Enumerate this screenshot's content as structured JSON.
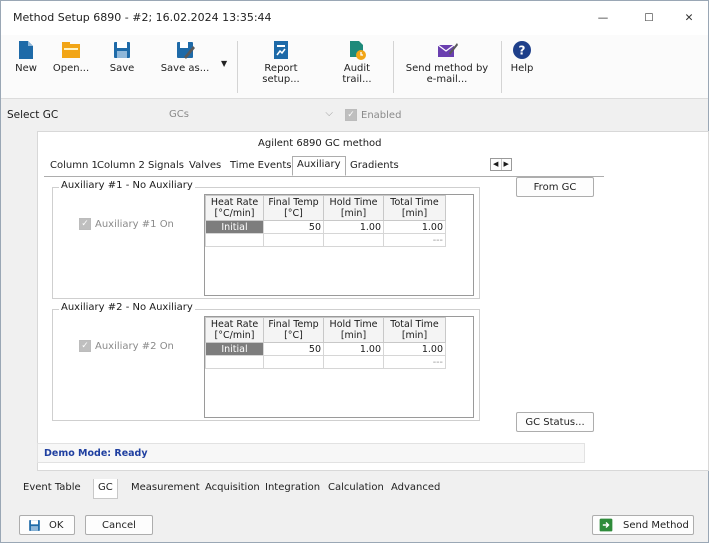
{
  "window": {
    "title": "Method Setup 6890 - #2;  16.02.2024  13:35:44",
    "controls": {
      "minimize": "—",
      "maximize": "☐",
      "close": "✕"
    }
  },
  "toolbar": {
    "new": "New",
    "open": "Open...",
    "save": "Save",
    "save_as": "Save as...",
    "report_setup": "Report setup...",
    "audit_trail": "Audit trail...",
    "send_method_line1": "Send method by",
    "send_method_line2": "e-mail...",
    "help": "Help"
  },
  "select_gc": {
    "label": "Select GC",
    "value": "GCs",
    "enabled_label": "Enabled"
  },
  "method": {
    "heading": "Agilent 6890 GC method",
    "tabs": [
      "Column 1",
      "Column 2",
      "Signals",
      "Valves",
      "Time Events",
      "Auxiliary",
      "Gradients"
    ],
    "active_tab": "Auxiliary"
  },
  "aux1": {
    "title": "Auxiliary #1 - No Auxiliary",
    "checkbox_label": "Auxiliary #1 On",
    "headers": [
      "Heat Rate\n[°C/min]",
      "Final Temp\n[°C]",
      "Hold Time\n[min]",
      "Total Time\n[min]"
    ],
    "h1": "Heat Rate",
    "h1u": "[°C/min]",
    "h2": "Final Temp",
    "h2u": "[°C]",
    "h3": "Hold Time",
    "h3u": "[min]",
    "h4": "Total Time",
    "h4u": "[min]",
    "row1": {
      "rate": "Initial",
      "temp": "50",
      "hold": "1.00",
      "total": "1.00"
    },
    "row2": {
      "total": "---"
    }
  },
  "aux2": {
    "title": "Auxiliary #2 - No Auxiliary",
    "checkbox_label": "Auxiliary #2 On",
    "h1": "Heat Rate",
    "h1u": "[°C/min]",
    "h2": "Final Temp",
    "h2u": "[°C]",
    "h3": "Hold Time",
    "h3u": "[min]",
    "h4": "Total Time",
    "h4u": "[min]",
    "row1": {
      "rate": "Initial",
      "temp": "50",
      "hold": "1.00",
      "total": "1.00"
    },
    "row2": {
      "total": "---"
    }
  },
  "buttons": {
    "from_gc": "From GC",
    "gc_status": "GC Status...",
    "ok": "OK",
    "cancel": "Cancel",
    "send_method": "Send Method"
  },
  "status_text": "Demo Mode: Ready",
  "bottom_tabs": [
    "Event Table",
    "GC",
    "Measurement",
    "Acquisition",
    "Integration",
    "Calculation",
    "Advanced"
  ],
  "active_bottom_tab": "GC",
  "colors": {
    "accent": "#1e6aa8",
    "status_text": "#1f3fa0",
    "initial_cell": "#7d7d7d",
    "send_icon": "#2e8b3a"
  }
}
